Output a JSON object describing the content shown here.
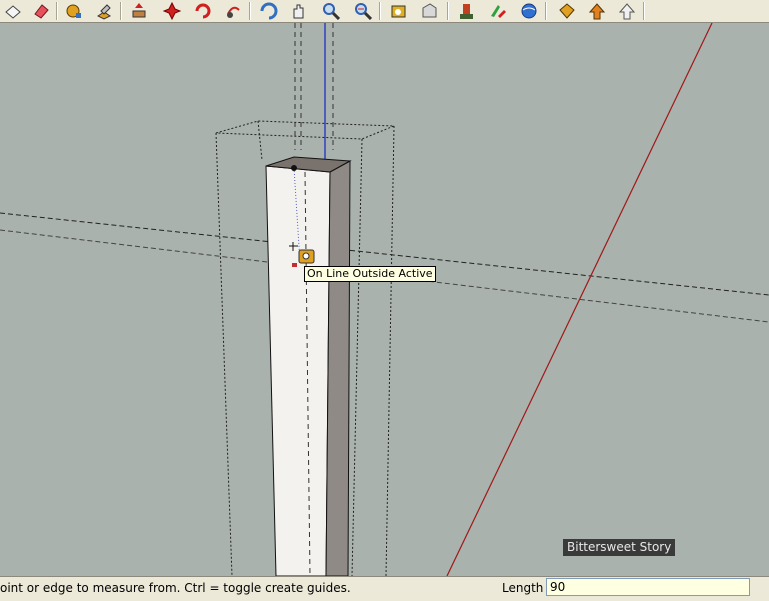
{
  "toolbar": {
    "buttons": [
      {
        "name": "select-icon",
        "color": "#f5f5f5"
      },
      {
        "name": "eraser-icon",
        "color": "#e8505b"
      },
      {
        "name": "paint-bucket-icon",
        "color": "#e0a020"
      },
      {
        "name": "push-pull-icon",
        "color": "#c84030"
      },
      {
        "name": "move-icon",
        "color": "#d02020"
      },
      {
        "name": "rotate-icon",
        "color": "#d02020"
      },
      {
        "name": "offset-icon",
        "color": "#d02020"
      },
      {
        "name": "orbit-icon",
        "color": "#3070c0"
      },
      {
        "name": "pan-icon",
        "color": "#f0f0f0"
      },
      {
        "name": "zoom-icon",
        "color": "#3060b0"
      },
      {
        "name": "zoom-extents-icon",
        "color": "#3060b0"
      },
      {
        "name": "tape-measure-icon",
        "color": "#e0b020"
      },
      {
        "name": "protractor-icon",
        "color": "#d0d0d0"
      },
      {
        "name": "walk-icon",
        "color": "#c04020"
      },
      {
        "name": "position-camera-icon",
        "color": "#30a040"
      },
      {
        "name": "look-around-icon",
        "color": "#3070d0"
      },
      {
        "name": "section-plane-icon",
        "color": "#e0a020"
      },
      {
        "name": "axes-icon",
        "color": "#e08020"
      },
      {
        "name": "dimension-icon",
        "color": "#f0f0f0"
      }
    ]
  },
  "viewport": {
    "tooltip": "On Line Outside Active",
    "watermark": "Bittersweet Story"
  },
  "status": {
    "hint": "oint or edge to measure from.  Ctrl = toggle create guides.",
    "vcb_label": "Length",
    "vcb_value": "90"
  }
}
